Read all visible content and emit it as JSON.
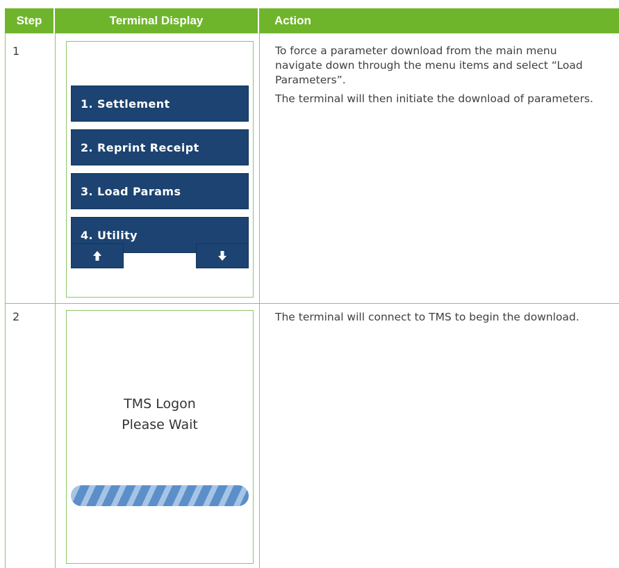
{
  "header": {
    "step": "Step",
    "display": "Terminal Display",
    "action": "Action"
  },
  "rows": [
    {
      "step": "1",
      "menu": [
        "1. Settlement",
        "2. Reprint Receipt",
        "3. Load Params",
        "4. Utility"
      ],
      "nav": {
        "up_icon": "arrow-up-icon",
        "down_icon": "arrow-down-icon"
      },
      "action": [
        "To force a parameter download from the main menu navigate down through the menu items and select “Load Parameters”.",
        "The terminal will then initiate the download of parameters."
      ]
    },
    {
      "step": "2",
      "screen_text": [
        "TMS Logon",
        "Please Wait"
      ],
      "action": [
        "The terminal will connect to TMS to begin the download."
      ]
    }
  ],
  "colors": {
    "header_bg": "#6fb52c",
    "button_bg": "#1c4371",
    "border": "#8cc56a"
  }
}
